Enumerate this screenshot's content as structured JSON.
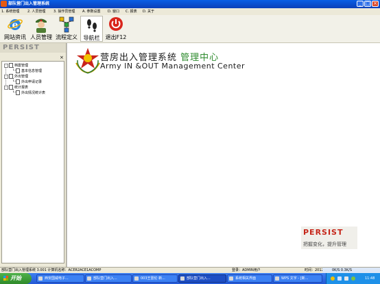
{
  "window": {
    "title": "部队营门出入管理系统",
    "controls": {
      "minimize": "_",
      "maximize": "□",
      "close": "×"
    }
  },
  "menu": {
    "items": [
      "1. 系统管理",
      "2. 人员管理",
      "3. 操作员管理",
      "A. 参数设置",
      "D. 窗口",
      "C. 报表",
      "D. 关于"
    ]
  },
  "toolbar": {
    "buttons": [
      {
        "label": "网站资讯",
        "icon": "ie-browser-icon"
      },
      {
        "label": "人员管理",
        "icon": "soldier-icon"
      },
      {
        "label": "流程定义",
        "icon": "flowchart-icon"
      },
      {
        "label": "导航栏",
        "icon": "footprints-icon"
      },
      {
        "label": "退出F12",
        "icon": "power-icon"
      }
    ]
  },
  "left_panel": {
    "header": "PERSIST",
    "close": "×",
    "tree": [
      {
        "label": "档案管理",
        "children": [
          "基本信息管理"
        ]
      },
      {
        "label": "外出管理",
        "children": [
          "外出申请记录"
        ]
      },
      {
        "label": "统计报表",
        "children": [
          "外出情况统计表"
        ]
      }
    ]
  },
  "main": {
    "title_cn": "营房出入管理系统",
    "title_cn_highlight": "管理中心",
    "title_en": "Army IN &OUT Management Center",
    "brand_name": "PERSIST",
    "brand_slogan": "把握变化，提升管理"
  },
  "status_bar": {
    "app": "部队营门出入管理系统 3.001 计算机名称：ACER2ACE1ACOMP",
    "login": "登录：ADMIN用户",
    "time_label": "时间：2012",
    "tray_text": "0K/S   0.3K/S"
  },
  "taskbar": {
    "start": "开始",
    "tasks": [
      "西安国威电子...",
      "部队营门出入...",
      "003王雷伦 新...",
      "部队营门出入...",
      "系统相关界面",
      "WPS 文字 - [新..."
    ],
    "active_task_index": 3,
    "clock": "11:48"
  },
  "colors": {
    "title_bar": "#0b3fb8",
    "highlight_green": "#2e8b2e",
    "brand_red": "#c6261a",
    "taskbar": "#2459d6",
    "start_green": "#3a9a34"
  }
}
